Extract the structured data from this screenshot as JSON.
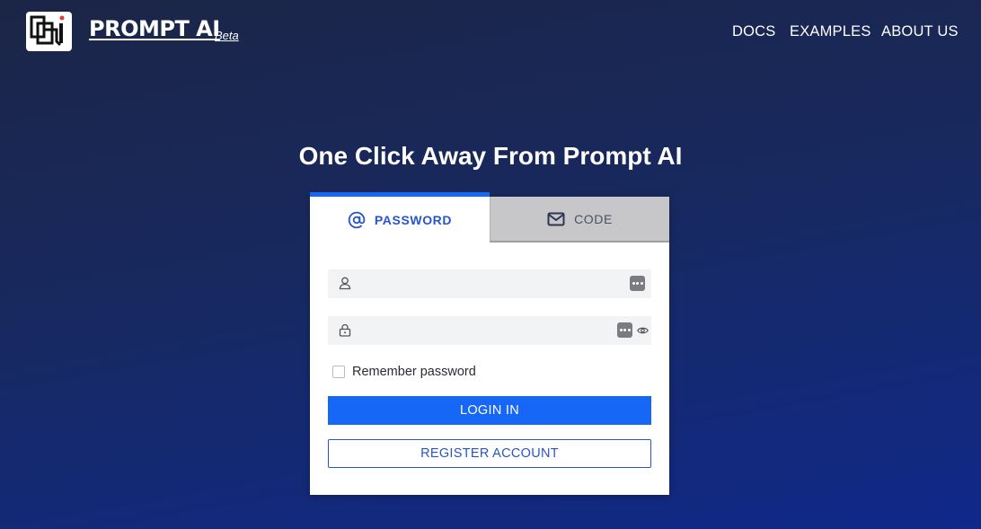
{
  "header": {
    "logo_icon": "prompt-ai-logo",
    "brand": "PROMPT AI",
    "beta": "Beta",
    "nav": [
      {
        "label": "DOCS"
      },
      {
        "label": "EXAMPLES"
      },
      {
        "label": "ABOUT US"
      }
    ]
  },
  "main": {
    "headline": "One Click Away From Prompt AI"
  },
  "login": {
    "tabs": [
      {
        "label": "PASSWORD",
        "icon": "at-sign-icon",
        "active": true
      },
      {
        "label": "CODE",
        "icon": "envelope-icon",
        "active": false
      }
    ],
    "username": {
      "value": "",
      "placeholder": "",
      "icon": "user-icon"
    },
    "password": {
      "value": "",
      "placeholder": "",
      "icon": "lock-icon"
    },
    "remember_label": "Remember password",
    "login_button": "LOGIN IN",
    "register_button": "REGISTER ACCOUNT"
  },
  "colors": {
    "accent": "#1767f6",
    "accent_text": "#2755c9",
    "background_top": "#1b2546",
    "background_bottom": "#10298a"
  }
}
